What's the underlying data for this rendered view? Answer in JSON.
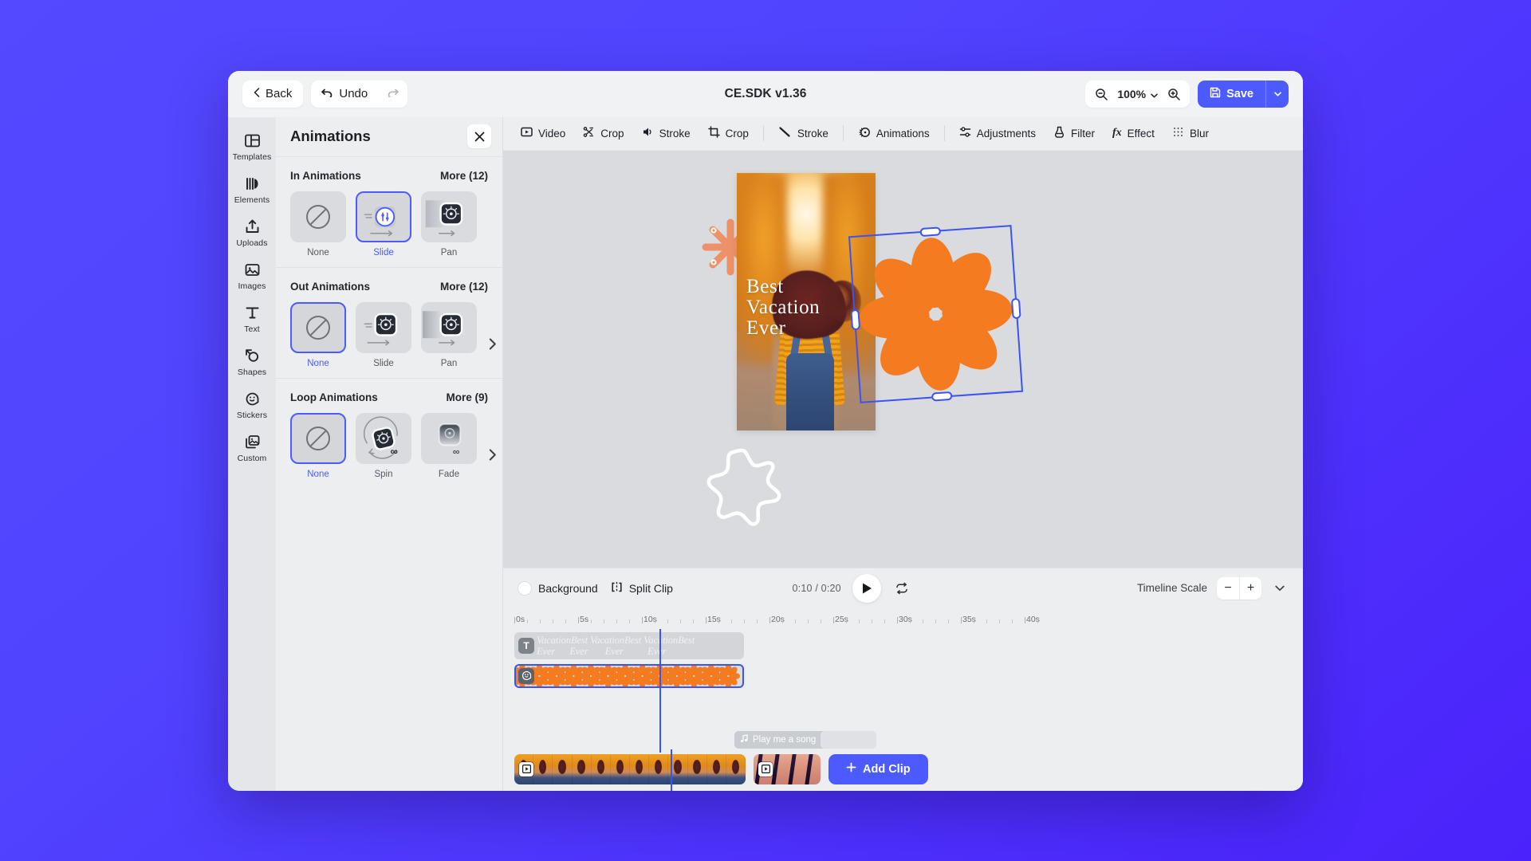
{
  "app": {
    "title": "CE.SDK v1.36"
  },
  "header": {
    "back_label": "Back",
    "undo_label": "Undo",
    "redo_icon": "redo-icon",
    "back_icon": "chevron-left-icon",
    "undo_icon": "undo-arrow-icon",
    "zoom_out_icon": "zoom-out-icon",
    "zoom_in_icon": "zoom-in-icon",
    "zoom_level": "100%",
    "zoom_caret_icon": "chevron-down-icon",
    "save_label": "Save",
    "save_icon": "floppy-disk-icon",
    "save_caret_icon": "chevron-down-icon",
    "accent_color": "#4b5bff"
  },
  "sidebar": {
    "items": [
      {
        "label": "Templates",
        "icon": "templates-icon"
      },
      {
        "label": "Elements",
        "icon": "elements-icon"
      },
      {
        "label": "Uploads",
        "icon": "upload-icon"
      },
      {
        "label": "Images",
        "icon": "image-icon"
      },
      {
        "label": "Text",
        "icon": "text-icon"
      },
      {
        "label": "Shapes",
        "icon": "shapes-icon"
      },
      {
        "label": "Stickers",
        "icon": "sticker-icon"
      },
      {
        "label": "Custom",
        "icon": "custom-icon"
      }
    ]
  },
  "animations_panel": {
    "title": "Animations",
    "close_icon": "close-icon",
    "sections": [
      {
        "title": "In Animations",
        "more_label": "More (12)",
        "has_next_arrow": false,
        "tiles": [
          {
            "label": "None",
            "selected": false,
            "icon": "none-slash-icon"
          },
          {
            "label": "Slide",
            "selected": true,
            "icon": "slide-animation-icon"
          },
          {
            "label": "Pan",
            "selected": false,
            "icon": "pan-animation-icon"
          }
        ]
      },
      {
        "title": "Out Animations",
        "more_label": "More (12)",
        "has_next_arrow": true,
        "tiles": [
          {
            "label": "None",
            "selected": true,
            "icon": "none-slash-icon"
          },
          {
            "label": "Slide",
            "selected": false,
            "icon": "slide-animation-icon"
          },
          {
            "label": "Pan",
            "selected": false,
            "icon": "pan-animation-icon"
          }
        ]
      },
      {
        "title": "Loop Animations",
        "more_label": "More (9)",
        "has_next_arrow": true,
        "tiles": [
          {
            "label": "None",
            "selected": true,
            "icon": "none-slash-icon"
          },
          {
            "label": "Spin",
            "selected": false,
            "icon": "spin-animation-icon"
          },
          {
            "label": "Fade",
            "selected": false,
            "icon": "fade-animation-icon"
          }
        ]
      }
    ]
  },
  "context_toolbar": {
    "items": [
      {
        "label": "Video",
        "icon": "video-icon",
        "separator_after": false
      },
      {
        "label": "Crop",
        "icon": "trim-icon",
        "separator_after": false
      },
      {
        "label": "Stroke",
        "icon": "volume-icon",
        "separator_after": false
      },
      {
        "label": "Crop",
        "icon": "crop-icon",
        "separator_after": true
      },
      {
        "label": "Stroke",
        "icon": "stroke-line-icon",
        "separator_after": true
      },
      {
        "label": "Animations",
        "icon": "animations-icon",
        "separator_after": true
      },
      {
        "label": "Adjustments",
        "icon": "adjustments-icon",
        "separator_after": false
      },
      {
        "label": "Filter",
        "icon": "filter-icon",
        "separator_after": false
      },
      {
        "label": "Effect",
        "icon": "effect-fx-icon",
        "separator_after": false
      },
      {
        "label": "Blur",
        "icon": "blur-icon",
        "separator_after": false
      }
    ]
  },
  "canvas": {
    "photo_text": "Best\nVacation\nEver",
    "flower_color": "#f47b20",
    "selection_color": "#3b54f0",
    "decorations": [
      "orange-asterisk",
      "white-asterisk",
      "white-outline-blob"
    ]
  },
  "timeline": {
    "background_label": "Background",
    "split_clip_label": "Split Clip",
    "split_clip_icon": "split-clip-icon",
    "current_time": "0:10",
    "total_time": "0:20",
    "time_display": "0:10 / 0:20",
    "play_icon": "play-icon",
    "loop_icon": "loop-icon",
    "scale_label": "Timeline Scale",
    "minus_label": "−",
    "plus_label": "+",
    "collapse_icon": "chevron-down-icon",
    "ruler_ticks": [
      "0s",
      "5s",
      "10s",
      "15s",
      "20s",
      "25s",
      "30s",
      "35s",
      "40s"
    ],
    "playhead_time": "10s",
    "tracks": [
      {
        "type": "text",
        "badge": "T",
        "content": "VacationBest VacationBest VacationBest\nEver      Ever       Ever          Ever",
        "selected": false
      },
      {
        "type": "sticker",
        "badge": "sticker-icon",
        "content": "flower-pattern",
        "selected": true
      },
      {
        "type": "audio",
        "badge": "music-note-icon",
        "content": "Play me a song",
        "selected": false
      }
    ],
    "add_clip_label": "Add Clip",
    "add_clip_icon": "plus-icon"
  }
}
